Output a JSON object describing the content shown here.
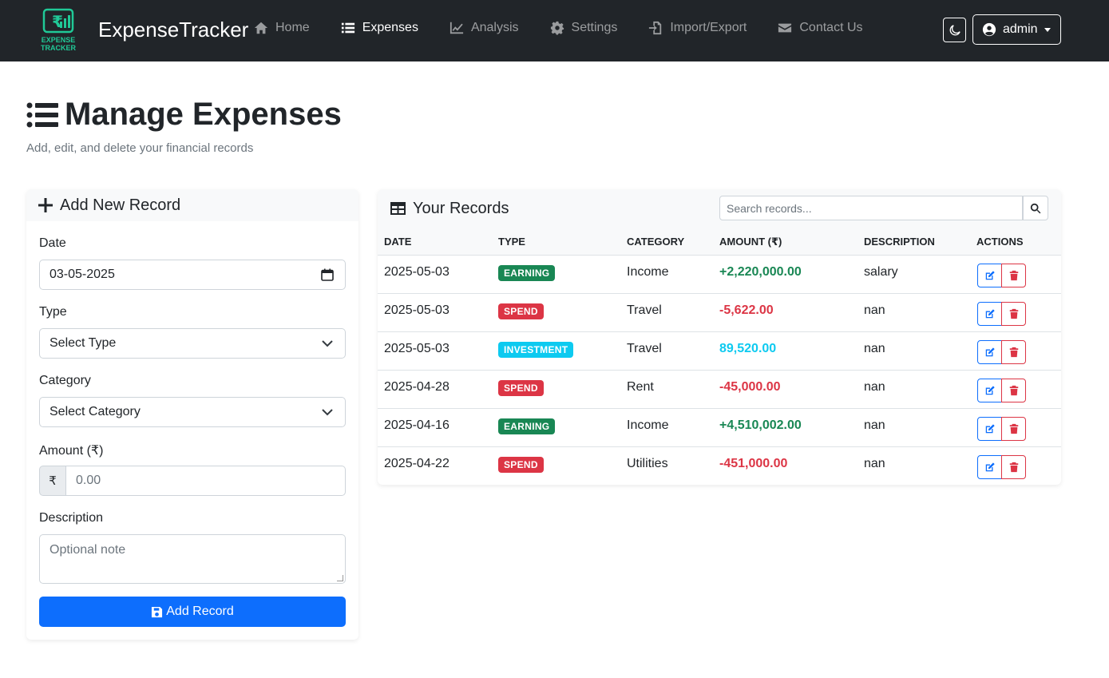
{
  "brand": {
    "logo_text_1": "EXPENSE",
    "logo_text_2": "TRACKER",
    "name": "ExpenseTracker"
  },
  "nav": [
    {
      "label": "Home",
      "icon": "home-icon"
    },
    {
      "label": "Expenses",
      "icon": "list-icon",
      "active": true
    },
    {
      "label": "Analysis",
      "icon": "chart-line-icon"
    },
    {
      "label": "Settings",
      "icon": "gear-icon"
    },
    {
      "label": "Import/Export",
      "icon": "file-import-icon"
    },
    {
      "label": "Contact Us",
      "icon": "envelope-icon"
    }
  ],
  "user": {
    "name": "admin"
  },
  "page": {
    "title": "Manage Expenses",
    "subtitle": "Add, edit, and delete your financial records"
  },
  "form": {
    "title": "Add New Record",
    "date_label": "Date",
    "date_value": "03-05-2025",
    "type_label": "Type",
    "type_value": "Select Type",
    "category_label": "Category",
    "category_value": "Select Category",
    "amount_label": "Amount (₹)",
    "amount_prefix": "₹",
    "amount_placeholder": "0.00",
    "description_label": "Description",
    "description_placeholder": "Optional note",
    "submit_label": "Add Record"
  },
  "records": {
    "title": "Your Records",
    "search_placeholder": "Search records...",
    "columns": [
      "DATE",
      "TYPE",
      "CATEGORY",
      "AMOUNT (₹)",
      "DESCRIPTION",
      "ACTIONS"
    ],
    "rows": [
      {
        "date": "2025-05-03",
        "type": "EARNING",
        "category": "Income",
        "amount": "+2,220,000.00",
        "description": "salary"
      },
      {
        "date": "2025-05-03",
        "type": "SPEND",
        "category": "Travel",
        "amount": "-5,622.00",
        "description": "nan"
      },
      {
        "date": "2025-05-03",
        "type": "INVESTMENT",
        "category": "Travel",
        "amount": "89,520.00",
        "description": "nan"
      },
      {
        "date": "2025-04-28",
        "type": "SPEND",
        "category": "Rent",
        "amount": "-45,000.00",
        "description": "nan"
      },
      {
        "date": "2025-04-16",
        "type": "EARNING",
        "category": "Income",
        "amount": "+4,510,002.00",
        "description": "nan"
      },
      {
        "date": "2025-04-22",
        "type": "SPEND",
        "category": "Utilities",
        "amount": "-451,000.00",
        "description": "nan"
      }
    ]
  },
  "colors": {
    "navbar": "#212529",
    "primary": "#0d6efd",
    "earning": "#198754",
    "spend": "#dc3545",
    "investment": "#0dcaf0",
    "logo": "#20c997"
  }
}
